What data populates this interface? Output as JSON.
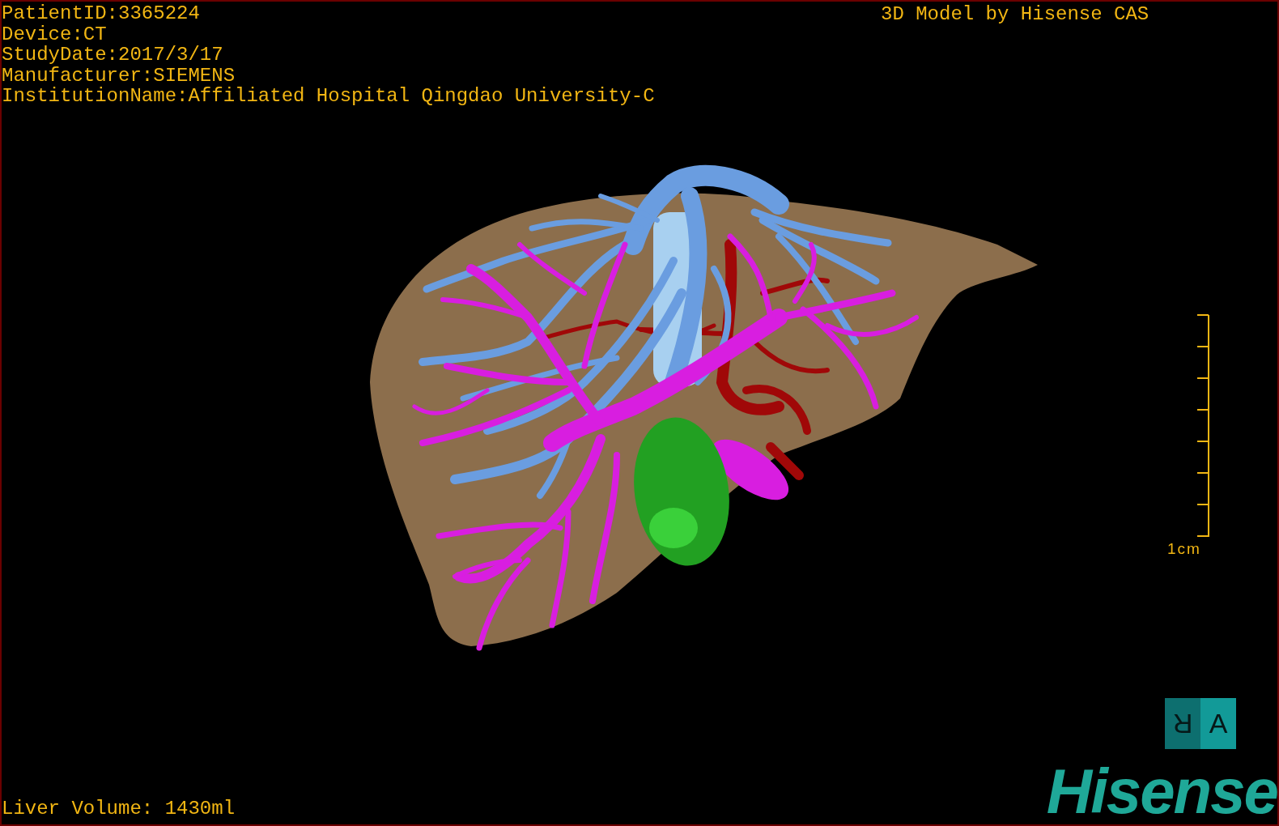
{
  "study_info": [
    "PatientID:3365224",
    "Device:CT",
    "StudyDate:2017/3/17",
    "Manufacturer:SIEMENS",
    "InstitutionName:Affiliated Hospital Qingdao University-C"
  ],
  "model_credit": "3D Model by Hisense CAS",
  "scale_bar": {
    "label": "1cm"
  },
  "orientation_cube": {
    "left_face": "R",
    "right_face": "A"
  },
  "logo": "Hisense",
  "liver_volume": "Liver Volume: 1430ml"
}
